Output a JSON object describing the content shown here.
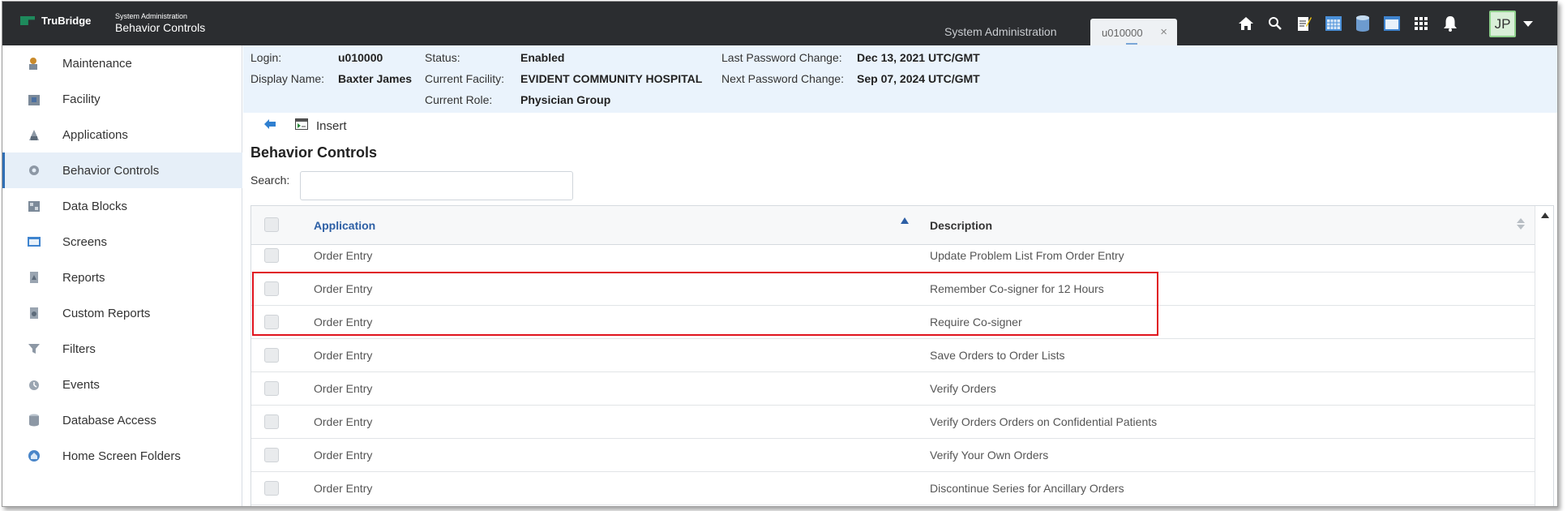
{
  "topbar": {
    "brand": "TruBridge",
    "module_small": "System Administration",
    "module_big": "Behavior Controls",
    "breadcrumb": "System Administration",
    "tab_label": "u010000",
    "tab_close": "×",
    "icons": [
      "home-icon",
      "search-icon",
      "notes-icon",
      "calendar-icon",
      "database-icon",
      "window-icon",
      "apps-grid-icon",
      "bell-icon"
    ],
    "avatar_initials": "JP"
  },
  "sidebar": {
    "items": [
      {
        "label": "Maintenance",
        "icon": "maintenance-icon",
        "active": false
      },
      {
        "label": "Facility",
        "icon": "facility-icon",
        "active": false
      },
      {
        "label": "Applications",
        "icon": "applications-icon",
        "active": false
      },
      {
        "label": "Behavior Controls",
        "icon": "behavior-controls-icon",
        "active": true
      },
      {
        "label": "Data Blocks",
        "icon": "data-blocks-icon",
        "active": false
      },
      {
        "label": "Screens",
        "icon": "screens-icon",
        "active": false
      },
      {
        "label": "Reports",
        "icon": "reports-icon",
        "active": false
      },
      {
        "label": "Custom Reports",
        "icon": "custom-reports-icon",
        "active": false
      },
      {
        "label": "Filters",
        "icon": "filters-icon",
        "active": false
      },
      {
        "label": "Events",
        "icon": "events-icon",
        "active": false
      },
      {
        "label": "Database Access",
        "icon": "database-access-icon",
        "active": false
      },
      {
        "label": "Home Screen Folders",
        "icon": "home-screen-folders-icon",
        "active": false
      }
    ]
  },
  "info": {
    "login_label": "Login:",
    "login_value": "u010000",
    "display_label": "Display Name:",
    "display_value": "Baxter James",
    "status_label": "Status:",
    "status_value": "Enabled",
    "facility_label": "Current Facility:",
    "facility_value": "EVIDENT COMMUNITY HOSPITAL",
    "role_label": "Current Role:",
    "role_value": "Physician Group",
    "last_pw_label": "Last Password Change:",
    "last_pw_value": "Dec 13, 2021 UTC/GMT",
    "next_pw_label": "Next Password Change:",
    "next_pw_value": "Sep 07, 2024 UTC/GMT"
  },
  "toolbar": {
    "insert_label": "Insert"
  },
  "section": {
    "title": "Behavior Controls",
    "search_label": "Search:",
    "search_value": ""
  },
  "table": {
    "columns": [
      "Application",
      "Description"
    ],
    "rows": [
      {
        "application": "Order Entry",
        "description": "Update Problem List From Order Entry"
      },
      {
        "application": "Order Entry",
        "description": "Remember Co-signer for 12 Hours"
      },
      {
        "application": "Order Entry",
        "description": "Require Co-signer"
      },
      {
        "application": "Order Entry",
        "description": "Save Orders to Order Lists"
      },
      {
        "application": "Order Entry",
        "description": "Verify Orders"
      },
      {
        "application": "Order Entry",
        "description": "Verify Orders Orders on Confidential Patients"
      },
      {
        "application": "Order Entry",
        "description": "Verify Your Own Orders"
      },
      {
        "application": "Order Entry",
        "description": "Discontinue Series for Ancillary Orders"
      }
    ]
  },
  "colors": {
    "topbar": "#2b2d30",
    "accent": "#2d5fa5",
    "highlight": "#e0141e",
    "info_bg": "#eaf3fc"
  }
}
